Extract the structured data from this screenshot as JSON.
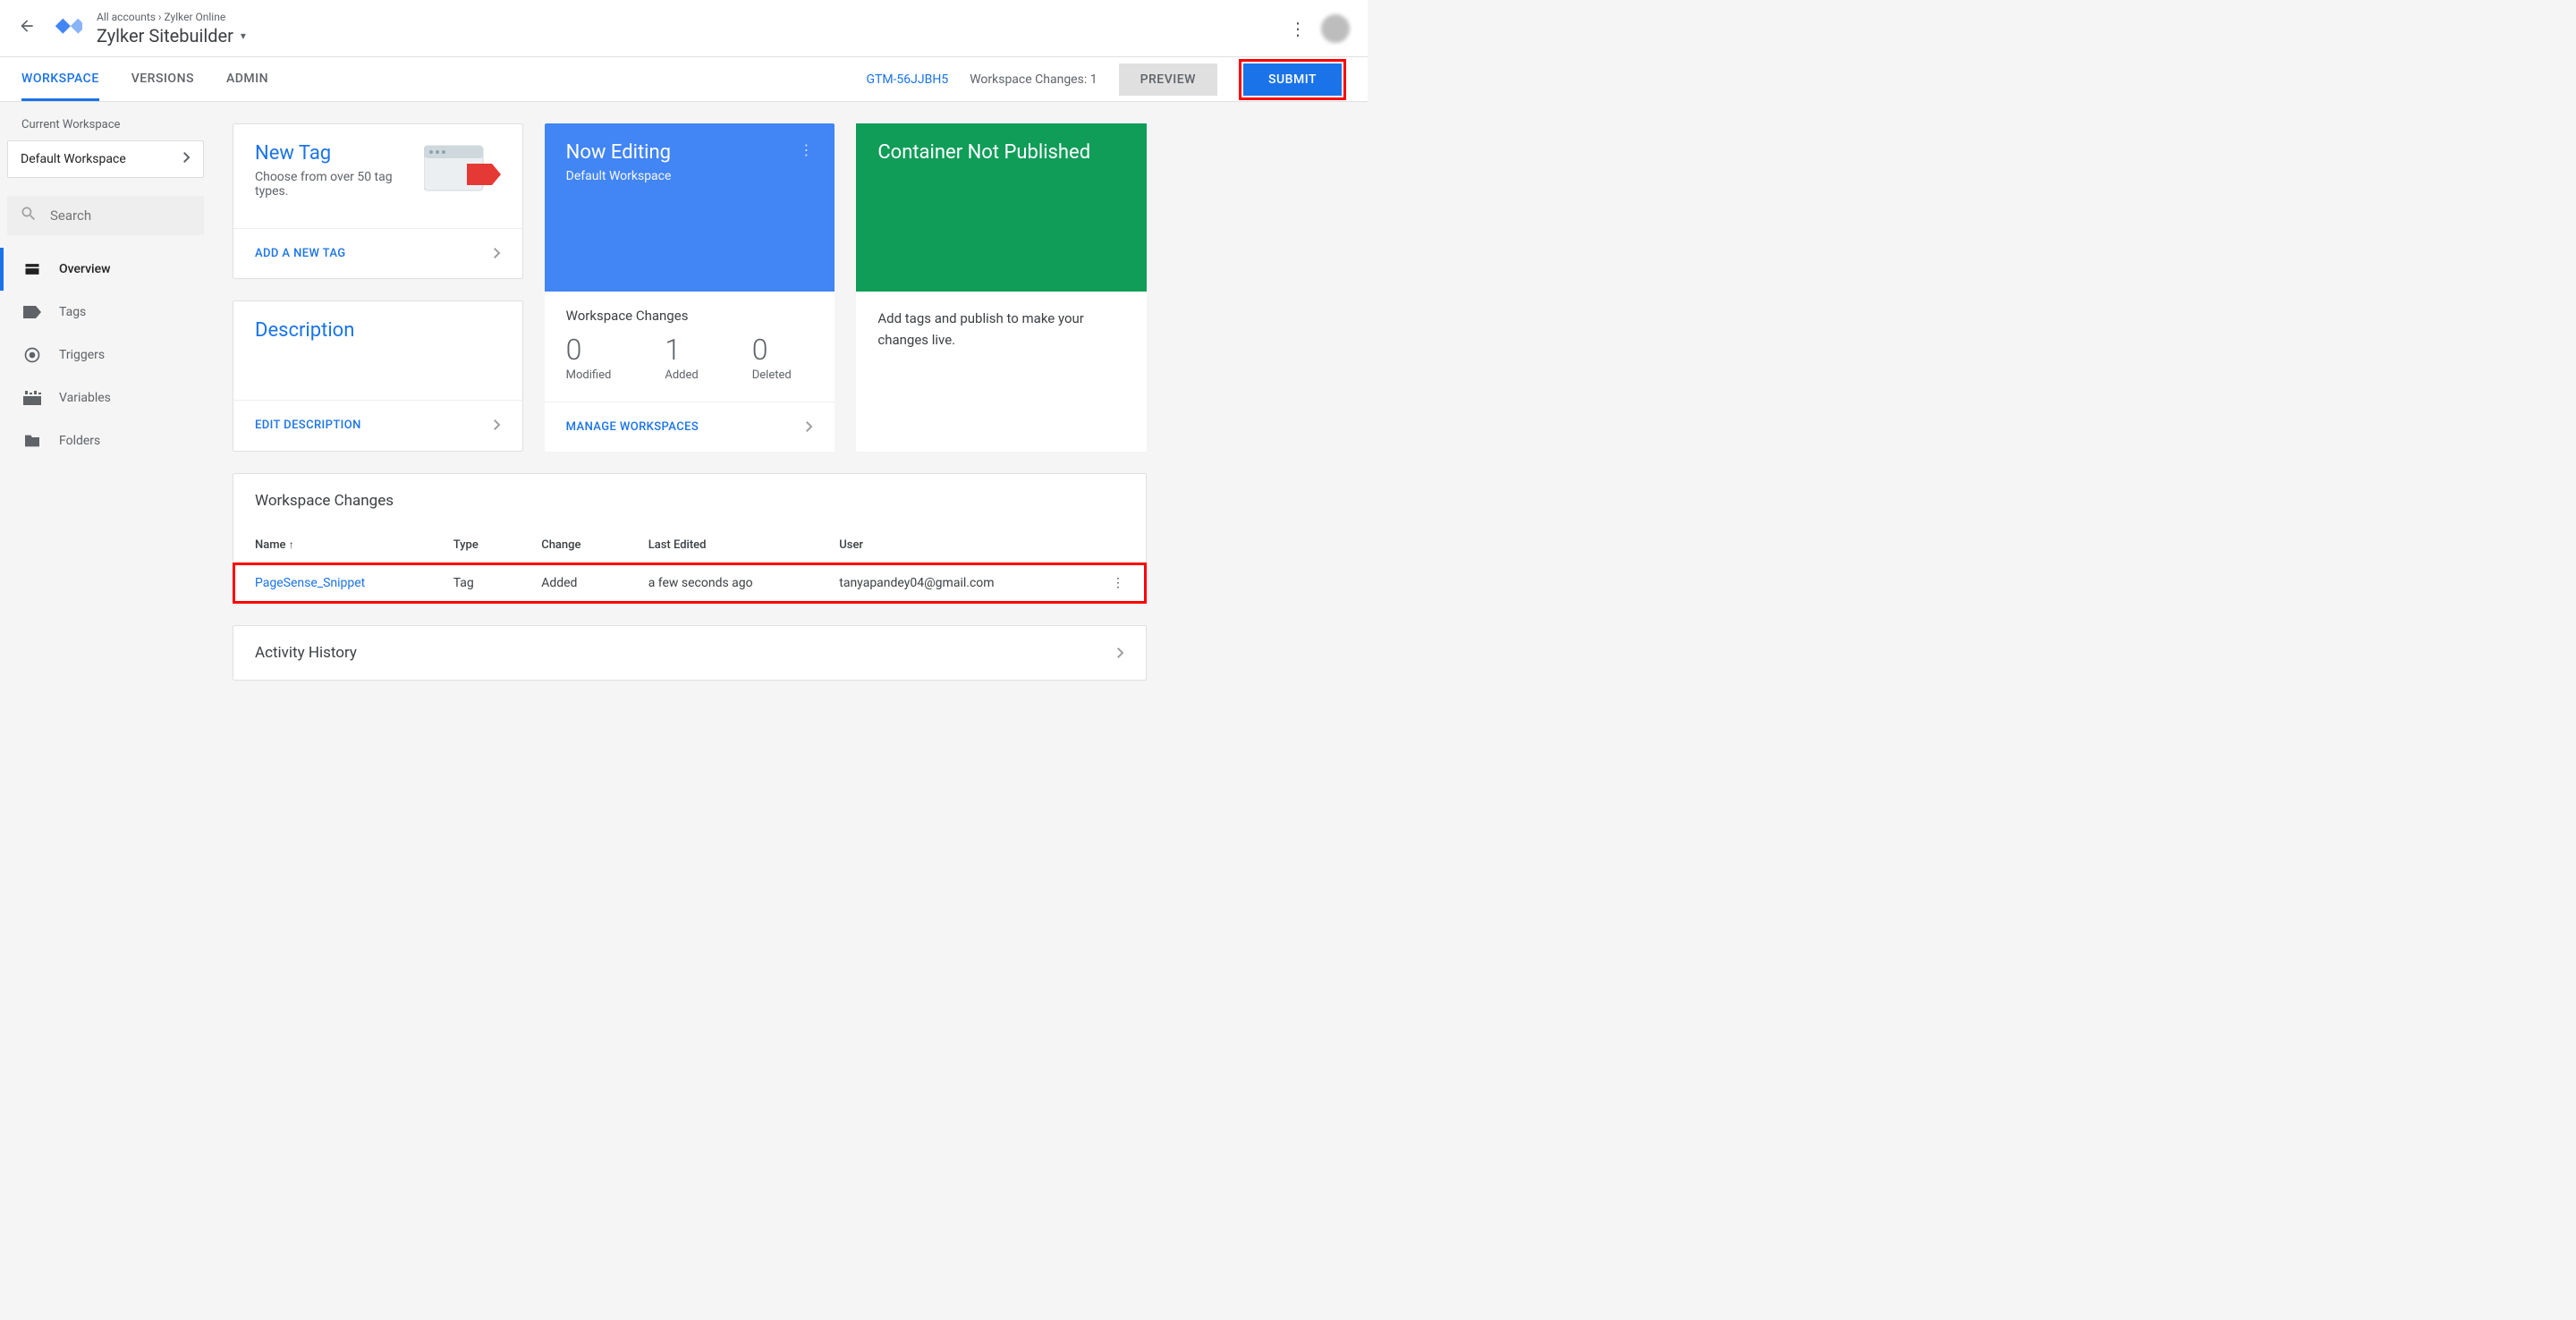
{
  "header": {
    "breadcrumb": "All accounts › Zylker Online",
    "title": "Zylker Sitebuilder"
  },
  "tabs": {
    "workspace": "WORKSPACE",
    "versions": "VERSIONS",
    "admin": "ADMIN",
    "container_id": "GTM-56JJBH5",
    "changes_label": "Workspace Changes: 1",
    "preview": "PREVIEW",
    "submit": "SUBMIT"
  },
  "sidebar": {
    "current_label": "Current Workspace",
    "current_value": "Default Workspace",
    "search_placeholder": "Search",
    "items": {
      "overview": "Overview",
      "tags": "Tags",
      "triggers": "Triggers",
      "variables": "Variables",
      "folders": "Folders"
    }
  },
  "newtag": {
    "title": "New Tag",
    "sub": "Choose from over 50 tag types.",
    "link": "ADD A NEW TAG"
  },
  "desc": {
    "title": "Description",
    "link": "EDIT DESCRIPTION"
  },
  "editing": {
    "title": "Now Editing",
    "sub": "Default Workspace",
    "wc_label": "Workspace Changes",
    "modified_n": "0",
    "modified_l": "Modified",
    "added_n": "1",
    "added_l": "Added",
    "deleted_n": "0",
    "deleted_l": "Deleted",
    "manage": "MANAGE WORKSPACES"
  },
  "published": {
    "title": "Container Not Published",
    "body": "Add tags and publish to make your changes live."
  },
  "wc_table": {
    "title": "Workspace Changes",
    "cols": {
      "name": "Name",
      "type": "Type",
      "change": "Change",
      "last": "Last Edited",
      "user": "User"
    },
    "row": {
      "name": "PageSense_Snippet",
      "type": "Tag",
      "change": "Added",
      "last": "a few seconds ago",
      "user": "tanyapandey04@gmail.com"
    }
  },
  "activity": {
    "title": "Activity History"
  }
}
